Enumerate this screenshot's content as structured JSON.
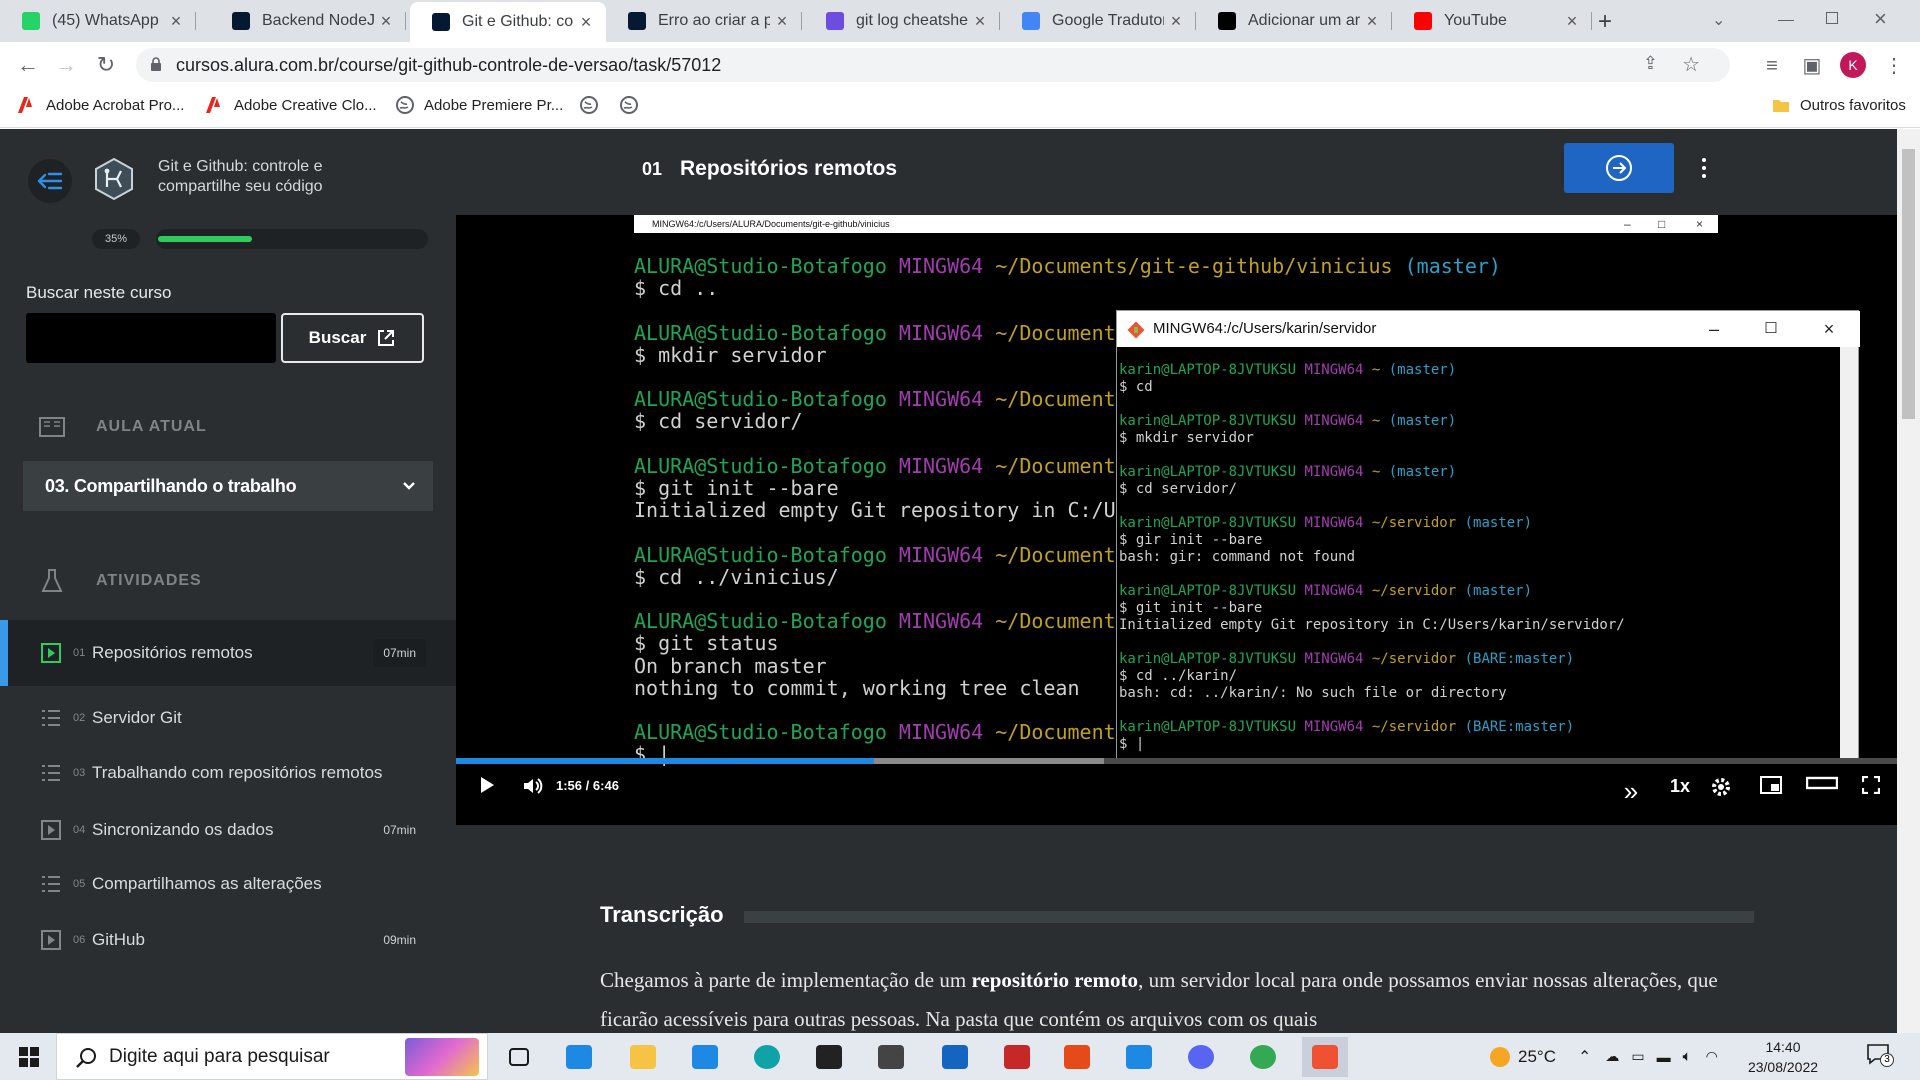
{
  "tabs": [
    {
      "title": "(45) WhatsApp",
      "icon": "whatsapp-icon",
      "color": "#25d366"
    },
    {
      "title": "Backend NodeJs | ",
      "icon": "alura-icon",
      "color": "#051933"
    },
    {
      "title": "Git e Github: cont",
      "icon": "alura-icon",
      "color": "#051933",
      "active": true
    },
    {
      "title": "Erro ao criar a pa",
      "icon": "alura-icon",
      "color": "#051933"
    },
    {
      "title": "git log cheatshee",
      "icon": "document-icon",
      "color": "#6c4de0"
    },
    {
      "title": "Google Tradutor",
      "icon": "translate-icon",
      "color": "#4285f4"
    },
    {
      "title": "Adicionar um arq",
      "icon": "github-icon",
      "color": "#000000"
    },
    {
      "title": "YouTube",
      "icon": "youtube-icon",
      "color": "#ff0000"
    }
  ],
  "url": "cursos.alura.com.br/course/git-github-controle-de-versao/task/57012",
  "profile_initial": "K",
  "bookmarks": [
    {
      "label": "Adobe Acrobat Pro...",
      "icon": "adobe-icon"
    },
    {
      "label": "Adobe Creative Clo...",
      "icon": "adobe-icon"
    },
    {
      "label": "Adobe Premiere Pr...",
      "icon": "globe-icon"
    },
    {
      "label": "",
      "icon": "globe-icon"
    },
    {
      "label": "",
      "icon": "globe-icon"
    }
  ],
  "bookmarks_other": "Outros favoritos",
  "sidebar": {
    "course_title": "Git e Github: controle e compartilhe seu código",
    "progress_label": "35%",
    "progress_value": 0.35,
    "search_label": "Buscar neste curso",
    "search_button": "Buscar",
    "current_lesson_header": "AULA ATUAL",
    "current_lesson": "03. Compartilhando o trabalho",
    "activities_header": "ATIVIDADES",
    "activities": [
      {
        "num": "01",
        "name": "Repositórios remotos",
        "duration": "07min",
        "type": "video",
        "current": true
      },
      {
        "num": "02",
        "name": "Servidor Git",
        "duration": "",
        "type": "text"
      },
      {
        "num": "03",
        "name": "Trabalhando com repositórios remotos",
        "duration": "",
        "type": "text"
      },
      {
        "num": "04",
        "name": "Sincronizando os dados",
        "duration": "07min",
        "type": "video"
      },
      {
        "num": "05",
        "name": "Compartilhamos as alterações",
        "duration": "",
        "type": "text"
      },
      {
        "num": "06",
        "name": "GitHub",
        "duration": "09min",
        "type": "video"
      }
    ]
  },
  "lesson": {
    "number": "01",
    "title": "Repositórios remotos"
  },
  "video": {
    "current_time": "1:56",
    "separator": "/",
    "duration": "6:46",
    "played_fraction": 0.29,
    "buffered_fraction": 0.45,
    "speed": "1x",
    "bg_terminal_title": "MINGW64:/c/Users/ALURA/Documents/git-e-github/vinicius",
    "bg_terminal_lines": [
      [
        {
          "t": "ALURA@Studio-Botafogo ",
          "c": "cg"
        },
        {
          "t": "MINGW64 ",
          "c": "cm"
        },
        {
          "t": "~/Documents/git-e-github/vinicius ",
          "c": "cy"
        },
        {
          "t": "(master)",
          "c": "cc"
        }
      ],
      [
        {
          "t": "$ cd ..",
          "c": "cw"
        }
      ],
      [],
      [
        {
          "t": "ALURA@Studio-Botafogo ",
          "c": "cg"
        },
        {
          "t": "MINGW64 ",
          "c": "cm"
        },
        {
          "t": "~/Documents",
          "c": "cy"
        }
      ],
      [
        {
          "t": "$ mkdir servidor",
          "c": "cw"
        }
      ],
      [],
      [
        {
          "t": "ALURA@Studio-Botafogo ",
          "c": "cg"
        },
        {
          "t": "MINGW64 ",
          "c": "cm"
        },
        {
          "t": "~/Documents",
          "c": "cy"
        }
      ],
      [
        {
          "t": "$ cd servidor/",
          "c": "cw"
        }
      ],
      [],
      [
        {
          "t": "ALURA@Studio-Botafogo ",
          "c": "cg"
        },
        {
          "t": "MINGW64 ",
          "c": "cm"
        },
        {
          "t": "~/Documents",
          "c": "cy"
        }
      ],
      [
        {
          "t": "$ git init --bare",
          "c": "cw"
        }
      ],
      [
        {
          "t": "Initialized empty Git repository in C:/Us",
          "c": "cw"
        }
      ],
      [],
      [
        {
          "t": "ALURA@Studio-Botafogo ",
          "c": "cg"
        },
        {
          "t": "MINGW64 ",
          "c": "cm"
        },
        {
          "t": "~/Documents",
          "c": "cy"
        }
      ],
      [
        {
          "t": "$ cd ../vinicius/",
          "c": "cw"
        }
      ],
      [],
      [
        {
          "t": "ALURA@Studio-Botafogo ",
          "c": "cg"
        },
        {
          "t": "MINGW64 ",
          "c": "cm"
        },
        {
          "t": "~/Documents",
          "c": "cy"
        }
      ],
      [
        {
          "t": "$ git status",
          "c": "cw"
        }
      ],
      [
        {
          "t": "On branch master",
          "c": "cw"
        }
      ],
      [
        {
          "t": "nothing to commit, working tree clean",
          "c": "cw"
        }
      ],
      [],
      [
        {
          "t": "ALURA@Studio-Botafogo ",
          "c": "cg"
        },
        {
          "t": "MINGW64 ",
          "c": "cm"
        },
        {
          "t": "~/Documents",
          "c": "cy"
        }
      ],
      [
        {
          "t": "$ |",
          "c": "cw"
        }
      ]
    ],
    "fg_terminal_title": "MINGW64:/c/Users/karin/servidor",
    "fg_terminal_lines": [
      [
        {
          "t": "karin@LAPTOP-8JVTUKSU ",
          "c": "cg"
        },
        {
          "t": "MINGW64 ",
          "c": "cm"
        },
        {
          "t": "~ ",
          "c": "cy"
        },
        {
          "t": "(master)",
          "c": "cc"
        }
      ],
      [
        {
          "t": "$ cd",
          "c": "cw"
        }
      ],
      [],
      [
        {
          "t": "karin@LAPTOP-8JVTUKSU ",
          "c": "cg"
        },
        {
          "t": "MINGW64 ",
          "c": "cm"
        },
        {
          "t": "~ ",
          "c": "cy"
        },
        {
          "t": "(master)",
          "c": "cc"
        }
      ],
      [
        {
          "t": "$ mkdir servidor",
          "c": "cw"
        }
      ],
      [],
      [
        {
          "t": "karin@LAPTOP-8JVTUKSU ",
          "c": "cg"
        },
        {
          "t": "MINGW64 ",
          "c": "cm"
        },
        {
          "t": "~ ",
          "c": "cy"
        },
        {
          "t": "(master)",
          "c": "cc"
        }
      ],
      [
        {
          "t": "$ cd servidor/",
          "c": "cw"
        }
      ],
      [],
      [
        {
          "t": "karin@LAPTOP-8JVTUKSU ",
          "c": "cg"
        },
        {
          "t": "MINGW64 ",
          "c": "cm"
        },
        {
          "t": "~/servidor ",
          "c": "cy"
        },
        {
          "t": "(master)",
          "c": "cc"
        }
      ],
      [
        {
          "t": "$ gir init --bare",
          "c": "cw"
        }
      ],
      [
        {
          "t": "bash: gir: command not found",
          "c": "cw"
        }
      ],
      [],
      [
        {
          "t": "karin@LAPTOP-8JVTUKSU ",
          "c": "cg"
        },
        {
          "t": "MINGW64 ",
          "c": "cm"
        },
        {
          "t": "~/servidor ",
          "c": "cy"
        },
        {
          "t": "(master)",
          "c": "cc"
        }
      ],
      [
        {
          "t": "$ git init --bare",
          "c": "cw"
        }
      ],
      [
        {
          "t": "Initialized empty Git repository in C:/Users/karin/servidor/",
          "c": "cw"
        }
      ],
      [],
      [
        {
          "t": "karin@LAPTOP-8JVTUKSU ",
          "c": "cg"
        },
        {
          "t": "MINGW64 ",
          "c": "cm"
        },
        {
          "t": "~/servidor ",
          "c": "cy"
        },
        {
          "t": "(BARE:master)",
          "c": "cc"
        }
      ],
      [
        {
          "t": "$ cd ../karin/",
          "c": "cw"
        }
      ],
      [
        {
          "t": "bash: cd: ../karin/: No such file or directory",
          "c": "cw"
        }
      ],
      [],
      [
        {
          "t": "karin@LAPTOP-8JVTUKSU ",
          "c": "cg"
        },
        {
          "t": "MINGW64 ",
          "c": "cm"
        },
        {
          "t": "~/servidor ",
          "c": "cy"
        },
        {
          "t": "(BARE:master)",
          "c": "cc"
        }
      ],
      [
        {
          "t": "$ |",
          "c": "cw"
        }
      ]
    ]
  },
  "transcript": {
    "header": "Transcrição",
    "p_before": "Chegamos à parte de implementação de um ",
    "p_bold": "repositório remoto",
    "p_after": ", um servidor local para onde possamos enviar nossas alterações, que ficarão acessíveis para outras pessoas. Na pasta que contém os arquivos com os quais"
  },
  "taskbar": {
    "search_placeholder": "Digite aqui para pesquisar",
    "weather": "25°C",
    "time": "14:40",
    "date": "23/08/2022",
    "notification_count": "3",
    "apps": [
      "task-view-icon",
      "mail-icon",
      "file-explorer-icon",
      "store-icon",
      "edge-icon",
      "terminal-icon",
      "settings-icon",
      "app-icon",
      "mcafee-icon",
      "office-icon",
      "vscode-icon",
      "discord-icon",
      "chrome-icon",
      "git-icon"
    ]
  },
  "colors": {
    "accent": "#1e88e5",
    "progress": "#2ecc5f",
    "sidebar": "#2a2e30",
    "next_button": "#1f66c4"
  }
}
